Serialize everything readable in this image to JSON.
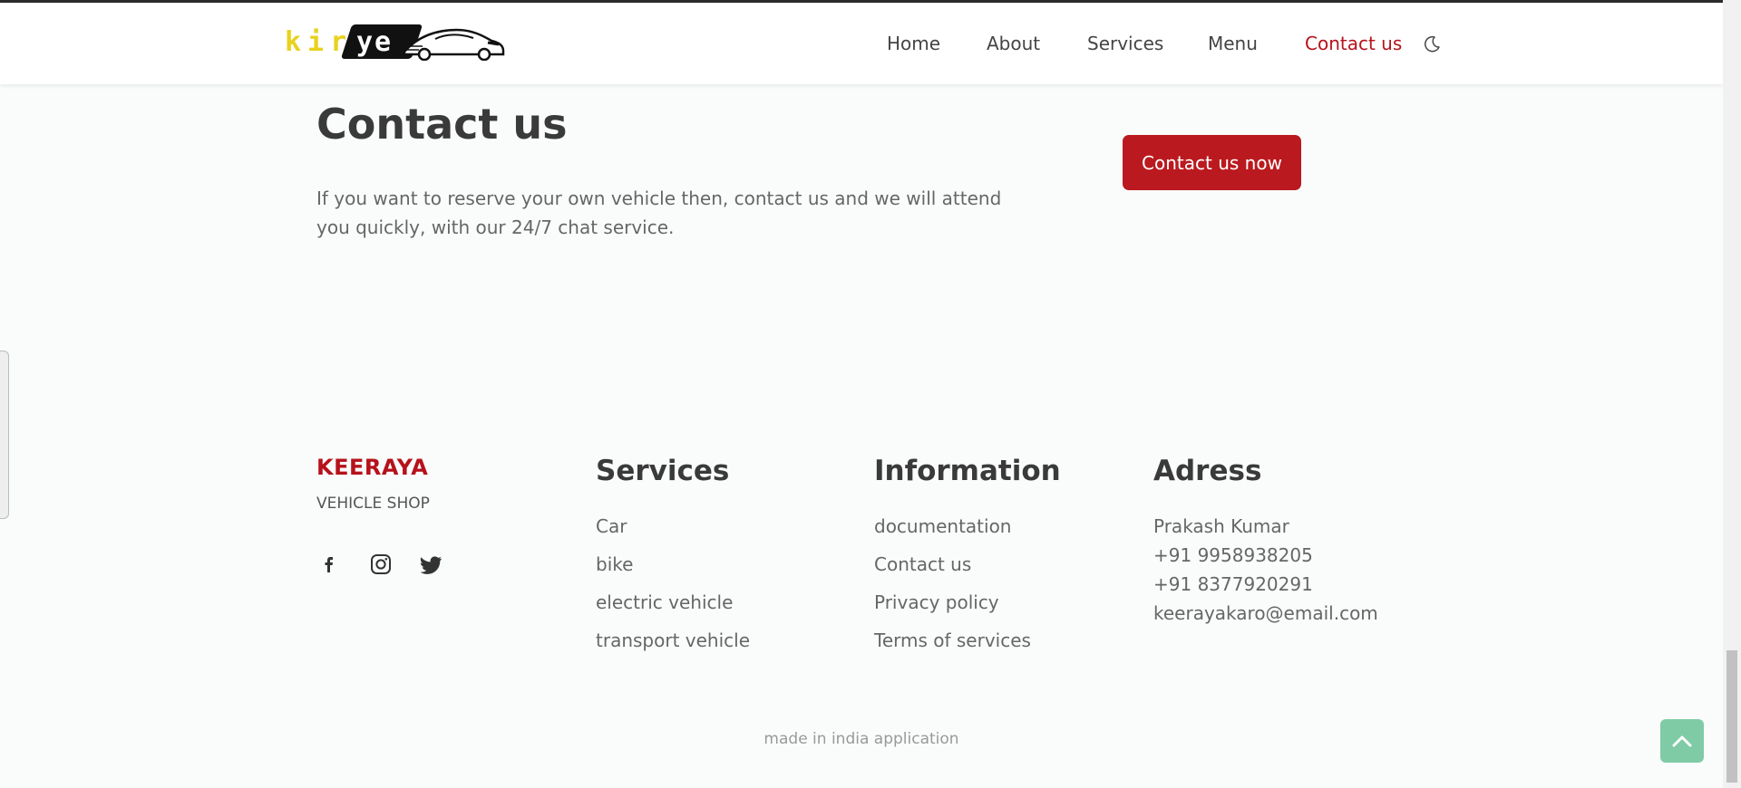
{
  "header": {
    "logo": {
      "text_part1": "kira",
      "text_part2": "ye"
    },
    "nav": [
      {
        "label": "Home"
      },
      {
        "label": "About"
      },
      {
        "label": "Services"
      },
      {
        "label": "Menu"
      },
      {
        "label": "Contact us",
        "active": true
      }
    ],
    "theme_toggle_icon": "moon-icon"
  },
  "contact": {
    "title": "Contact us",
    "description": "If you want to reserve your own vehicle then, contact us and we will attend you quickly, with our 24/7 chat service.",
    "button_label": "Contact us now"
  },
  "footer": {
    "brand": "KEERAYA",
    "brand_sub": "VEHICLE SHOP",
    "social": [
      {
        "icon": "facebook-icon"
      },
      {
        "icon": "instagram-icon"
      },
      {
        "icon": "twitter-icon"
      }
    ],
    "services": {
      "title": "Services",
      "links": [
        "Car",
        "bike",
        "electric vehicle",
        "transport vehicle"
      ]
    },
    "information": {
      "title": "Information",
      "links": [
        "documentation",
        "Contact us",
        "Privacy policy",
        "Terms of services"
      ]
    },
    "address": {
      "title": "Adress",
      "lines": [
        "Prakash Kumar",
        "+91 9958938205",
        "+91 8377920291",
        "keerayakaro@email.com"
      ]
    },
    "made_in": "made in india application"
  },
  "colors": {
    "accent": "#b6121b",
    "button_bg": "#ba1a1f",
    "logo_yellow": "#e8d21d",
    "to_top_bg": "#7fcba5"
  }
}
